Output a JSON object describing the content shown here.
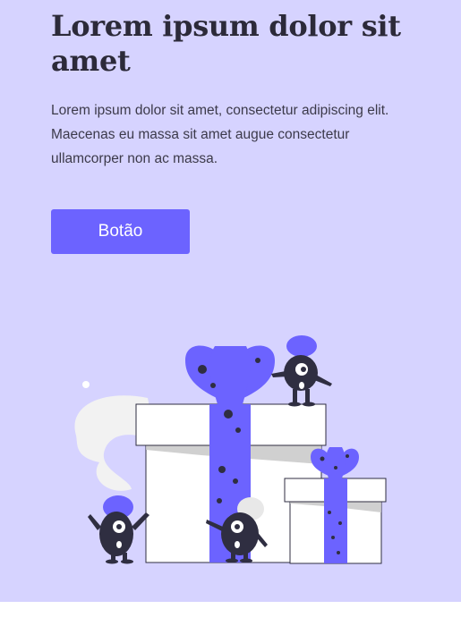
{
  "hero": {
    "title": "Lorem ipsum dolor sit amet",
    "description": "Lorem ipsum dolor sit amet, consectetur adipiscing elit. Maecenas eu massa sit amet augue consectetur ullamcorper non ac massa.",
    "button_label": "Botão"
  },
  "colors": {
    "background": "#d6d3ff",
    "accent": "#6c63ff",
    "text_dark": "#2c2a39",
    "page_below": "#ffffff"
  },
  "illustration": {
    "icon": "gift-boxes-with-monsters-illustration"
  }
}
